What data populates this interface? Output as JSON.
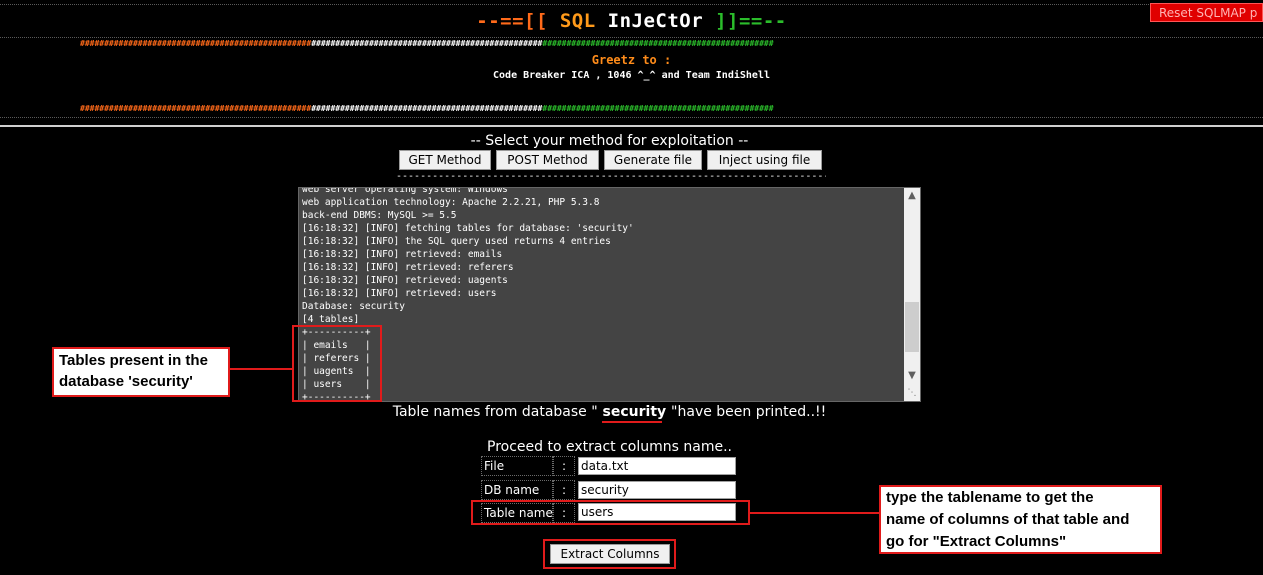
{
  "header": {
    "reset_button": "Reset SQLMAP p",
    "title": {
      "prefix": "--==[[ ",
      "sql": "SQL ",
      "injector": "InJeCtOr",
      "suffix": " ]]==--"
    },
    "greetz_label": "Greetz to :",
    "greetz_names": "Code Breaker ICA , 1046 ^_^ and Team IndiShell"
  },
  "method": {
    "heading": "-- Select your method for exploitation --",
    "buttons": {
      "get": "GET Method",
      "post": "POST Method",
      "generate": "Generate file",
      "inject": "Inject using file"
    },
    "separator": "--------------------------------------------------------------------------------------------"
  },
  "console": {
    "lines": [
      "web server operating system: Windows",
      "web application technology: Apache 2.2.21, PHP 5.3.8",
      "back-end DBMS: MySQL >= 5.5",
      "[16:18:32] [INFO] fetching tables for database: 'security'",
      "[16:18:32] [INFO] the SQL query used returns 4 entries",
      "[16:18:32] [INFO] retrieved: emails",
      "[16:18:32] [INFO] retrieved: referers",
      "[16:18:32] [INFO] retrieved: uagents",
      "[16:18:32] [INFO] retrieved: users",
      "Database: security",
      "[4 tables]",
      "+----------+",
      "| emails   |",
      "| referers |",
      "| uagents  |",
      "| users    |",
      "+----------+"
    ]
  },
  "annotations": {
    "tables": {
      "line1": "Tables present in the",
      "line2": "database 'security'"
    },
    "columns": {
      "line1": "type the tablename to get the",
      "line2": "name of columns of that table and",
      "line3": "go for \"Extract Columns\""
    }
  },
  "result": {
    "prefix": "Table names from database \"",
    "db": " security ",
    "suffix": "\"have been printed..!!"
  },
  "form": {
    "heading": "Proceed to extract columns name..",
    "colon": ":",
    "file_label": "File",
    "file_value": "data.txt",
    "db_label": "DB name",
    "db_value": "security",
    "table_label": "Table name",
    "table_value": "users",
    "submit": "Extract Columns"
  },
  "colors": {
    "accent_orange": "#ff6a1a",
    "accent_green": "#2bbd2b",
    "annotation_red": "#e01b1b",
    "console_bg": "#444444"
  },
  "icons": [
    "scroll-up-icon",
    "scroll-down-icon",
    "resize-grip-icon"
  ]
}
